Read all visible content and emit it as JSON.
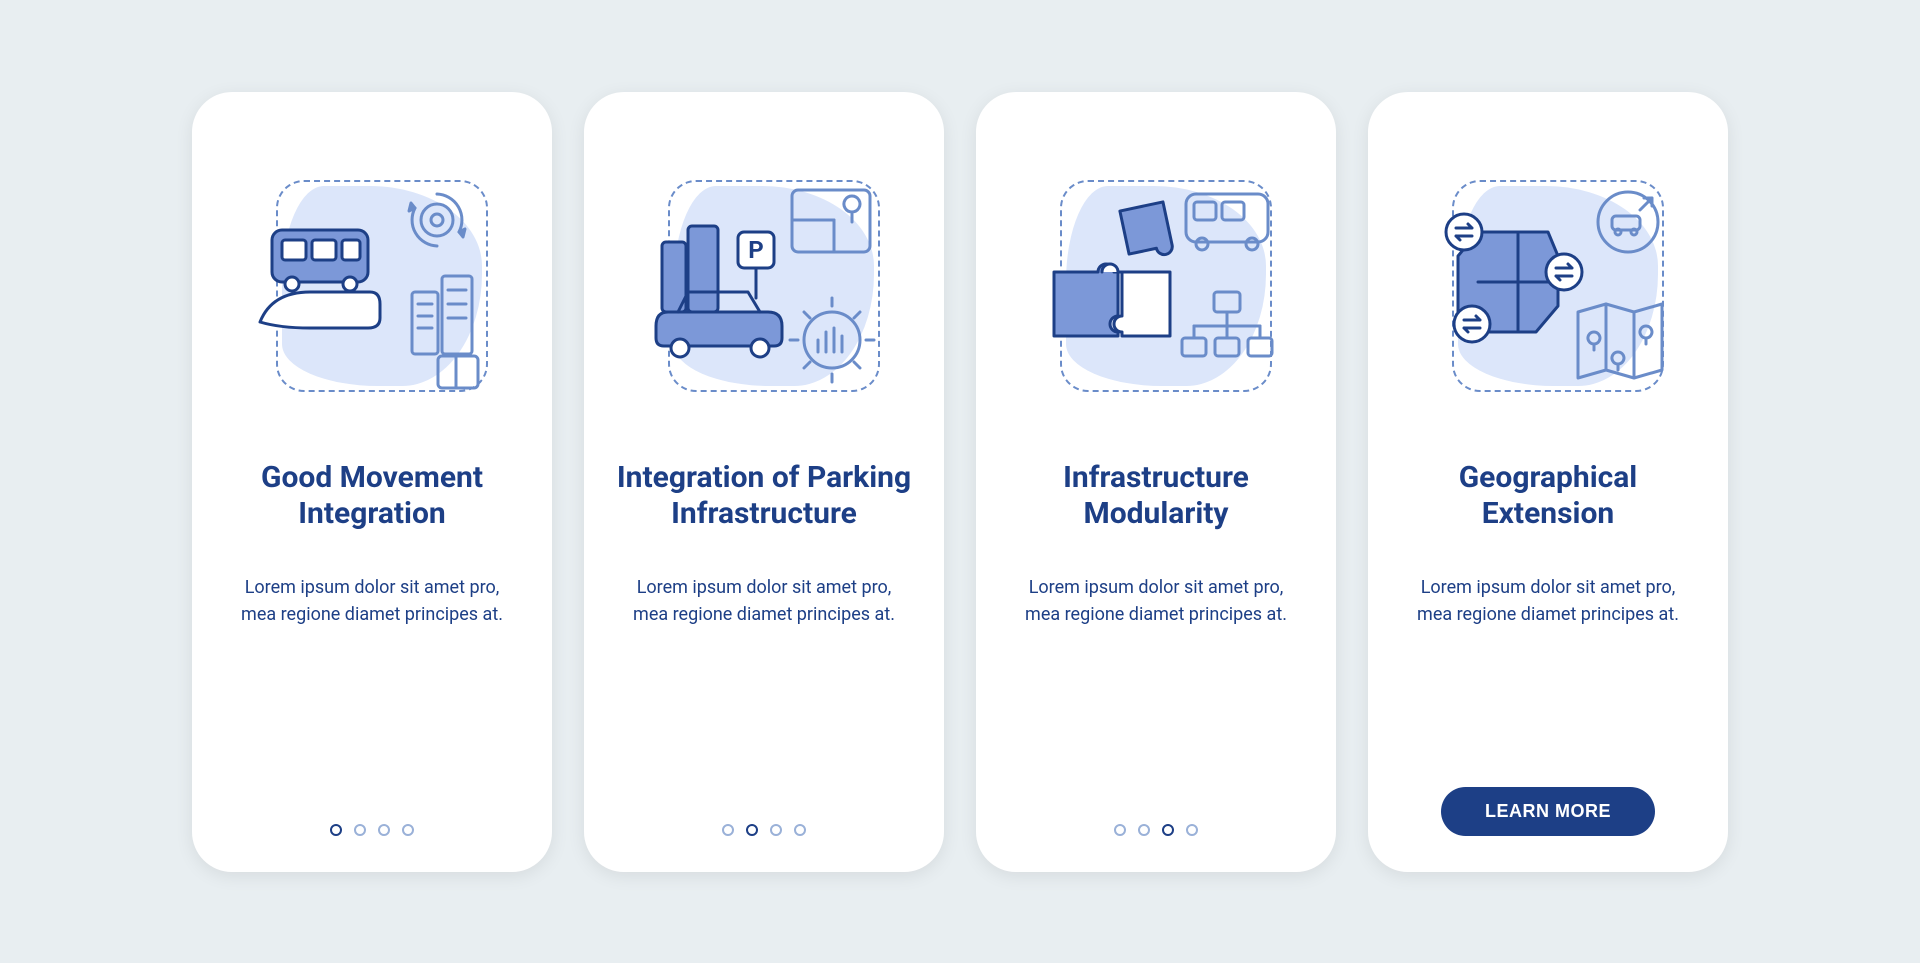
{
  "colors": {
    "primary": "#1d3f86",
    "accent_fill": "#7c98d8",
    "light_bg": "#dce6fa",
    "stroke": "#6a8cc9",
    "page_bg": "#e8eef1"
  },
  "cta_label": "LEARN MORE",
  "screens": [
    {
      "title": "Good Movement Integration",
      "body": "Lorem ipsum dolor sit amet pro, mea regione diamet principes at.",
      "active_index": 0,
      "total": 4
    },
    {
      "title": "Integration of Parking Infrastructure",
      "body": "Lorem ipsum dolor sit amet pro, mea regione diamet principes at.",
      "active_index": 1,
      "total": 4
    },
    {
      "title": "Infrastructure Modularity",
      "body": "Lorem ipsum dolor sit amet pro, mea regione diamet principes at.",
      "active_index": 2,
      "total": 4
    },
    {
      "title": "Geographical Extension",
      "body": "Lorem ipsum dolor sit amet pro, mea regione diamet principes at.",
      "active_index": 3,
      "total": 4
    }
  ]
}
